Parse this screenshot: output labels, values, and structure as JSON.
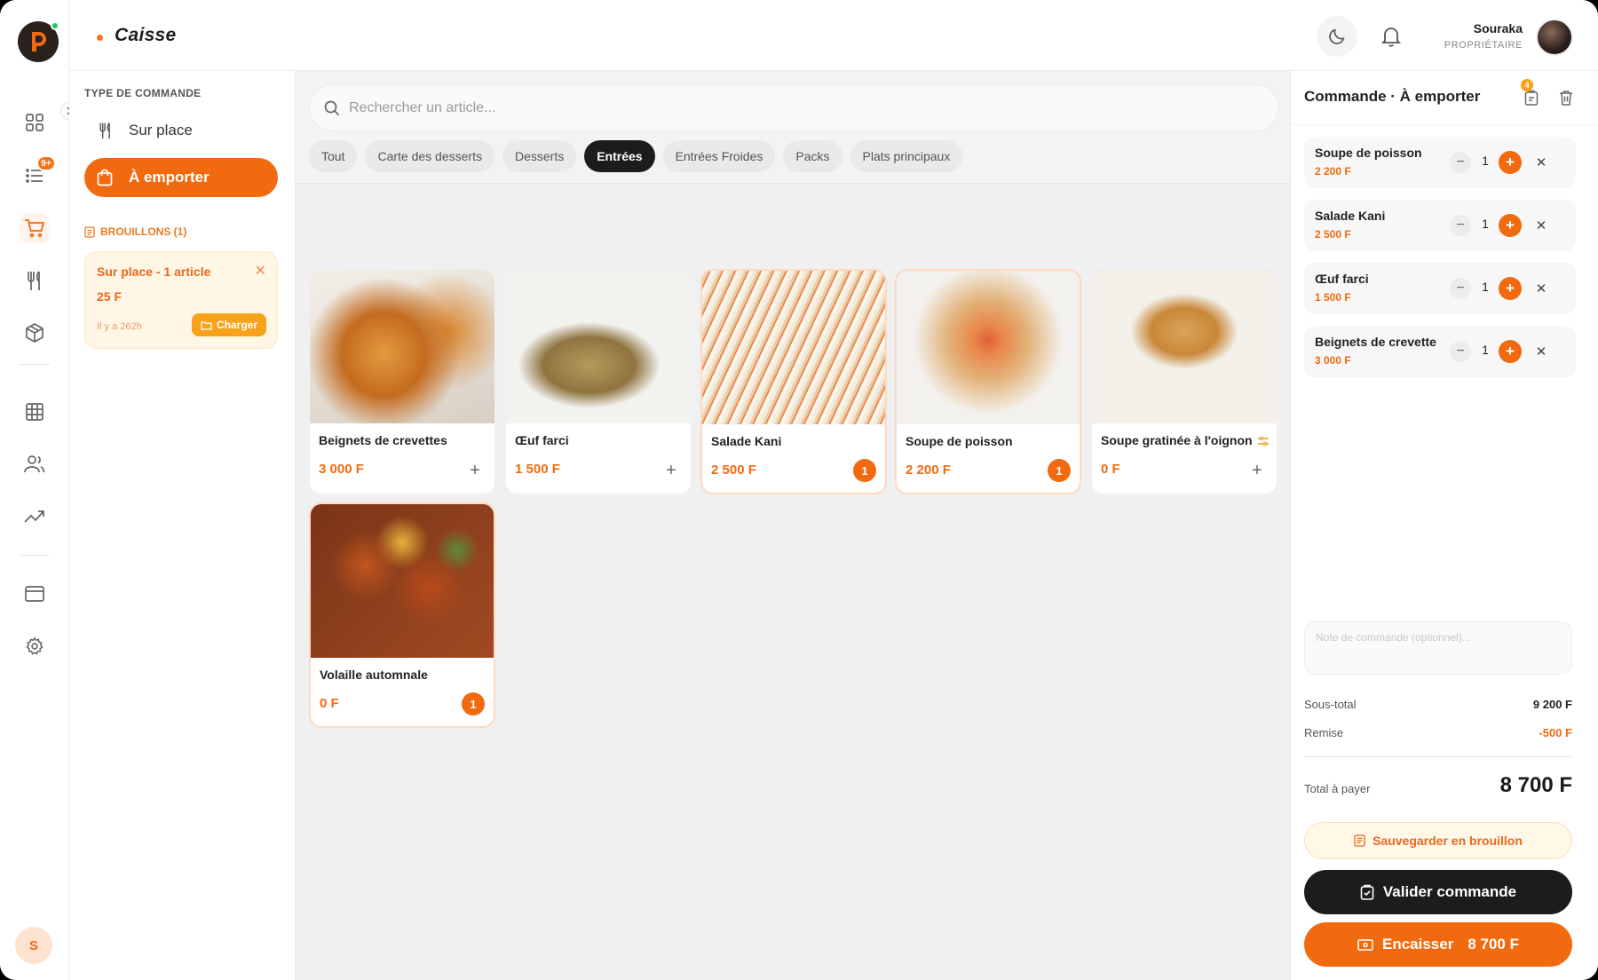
{
  "header": {
    "title": "Caisse",
    "user_name": "Souraka",
    "user_role": "PROPRIÉTAIRE"
  },
  "rail": {
    "nav_icons": [
      "dashboard-icon",
      "orders-list-icon",
      "cart-icon",
      "menu-utensils-icon",
      "package-icon",
      "tables-grid-icon",
      "customers-icon",
      "analytics-icon",
      "payments-card-icon",
      "settings-gear-icon"
    ],
    "orders_badge": "9+",
    "avatar_initial": "S"
  },
  "order_type": {
    "label": "TYPE DE COMMANDE",
    "on_site": "Sur place",
    "takeaway": "À emporter",
    "selected": "takeaway"
  },
  "drafts": {
    "title": "BROUILLONS (1)",
    "items": [
      {
        "title": "Sur place - 1 article",
        "amount": "25 F",
        "time": "Il y a 262h",
        "load_label": "Charger"
      }
    ]
  },
  "search": {
    "placeholder": "Rechercher un article..."
  },
  "categories": [
    {
      "label": "Tout",
      "active": false
    },
    {
      "label": "Carte des desserts",
      "active": false
    },
    {
      "label": "Desserts",
      "active": false
    },
    {
      "label": "Entrées",
      "active": true
    },
    {
      "label": "Entrées Froides",
      "active": false
    },
    {
      "label": "Packs",
      "active": false
    },
    {
      "label": "Plats principaux",
      "active": false
    }
  ],
  "products": [
    {
      "name": "Beignets de crevettes",
      "price": "3 000 F",
      "qty": null
    },
    {
      "name": "Œuf farci",
      "price": "1 500 F",
      "qty": null
    },
    {
      "name": "Salade Kani",
      "price": "2 500 F",
      "qty": "1"
    },
    {
      "name": "Soupe de poisson",
      "price": "2 200 F",
      "qty": "1"
    },
    {
      "name": "Soupe gratinée à l'oignon",
      "price": "0 F",
      "qty": null
    },
    {
      "name": "Volaille automnale",
      "price": "0 F",
      "qty": "1"
    }
  ],
  "order": {
    "title": "Commande · À emporter",
    "draft_badge": "4",
    "items": [
      {
        "name": "Soupe de poisson",
        "price": "2 200 F",
        "qty": "1"
      },
      {
        "name": "Salade Kani",
        "price": "2 500 F",
        "qty": "1"
      },
      {
        "name": "Œuf farci",
        "price": "1 500 F",
        "qty": "1"
      },
      {
        "name": "Beignets de crevette",
        "price": "3 000 F",
        "qty": "1"
      }
    ],
    "note_placeholder": "Note de commande (optionnel)...",
    "subtotal_label": "Sous-total",
    "subtotal": "9 200 F",
    "discount_label": "Remise",
    "discount": "-500 F",
    "total_label": "Total à payer",
    "total": "8 700 F",
    "save_draft_label": "Sauvegarder en brouillon",
    "validate_label": "Valider commande",
    "pay_label": "Encaisser",
    "pay_amount": "8 700 F"
  },
  "colors": {
    "accent": "#f26a0f",
    "dark": "#1c1c1c",
    "draft_bg": "#fff6e6"
  }
}
